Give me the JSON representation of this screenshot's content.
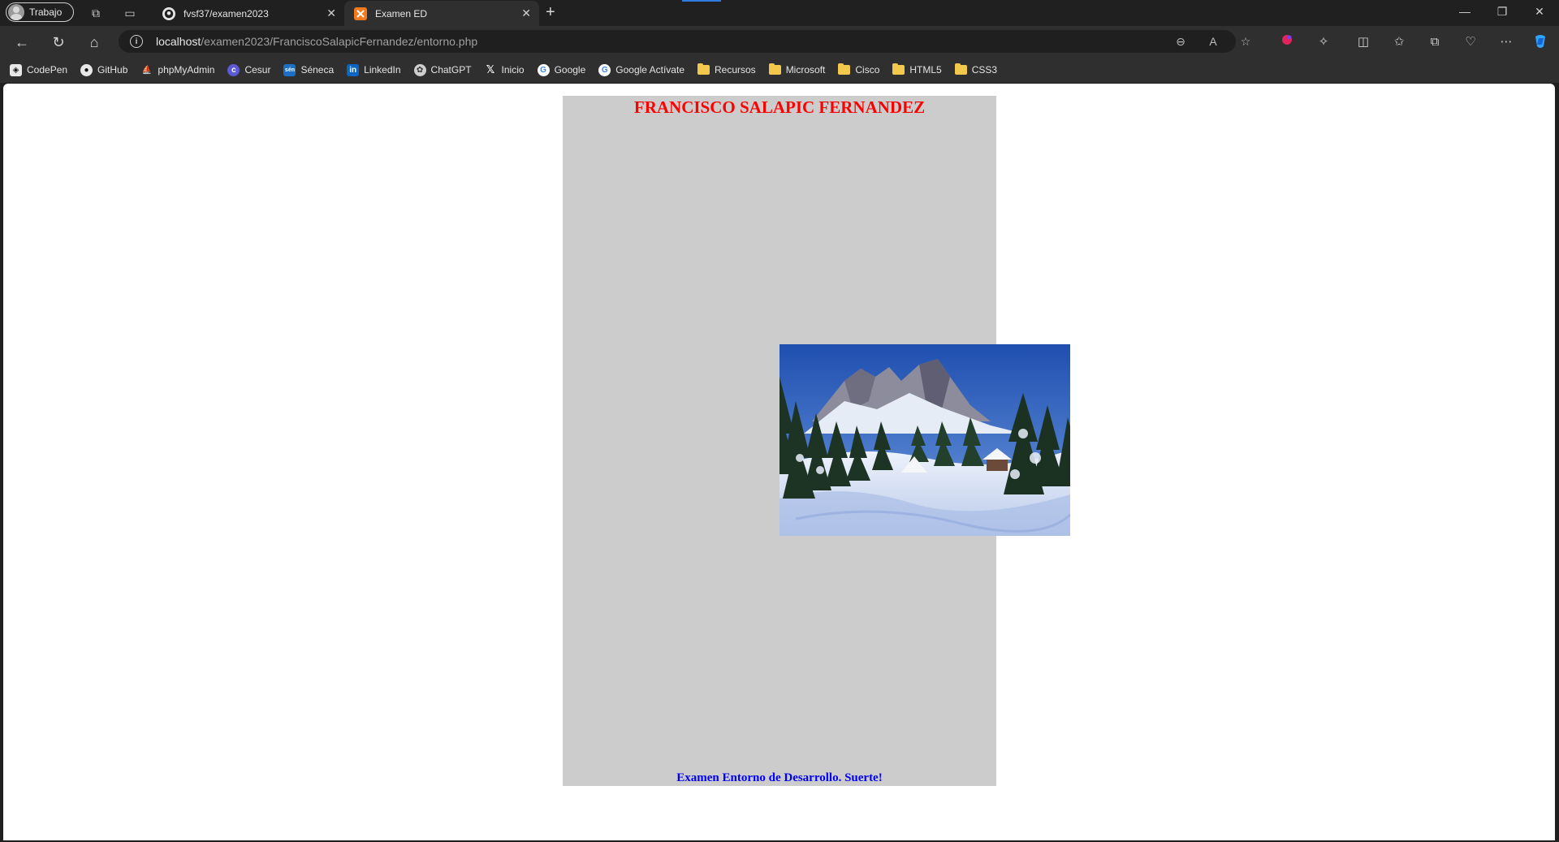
{
  "browser": {
    "profile_label": "Trabajo",
    "tabs": [
      {
        "title": "fvsf37/examen2023",
        "icon": "github-icon"
      },
      {
        "title": "Examen ED",
        "icon": "xampp-icon"
      }
    ],
    "url_host": "localhost",
    "url_path": "/examen2023/FranciscoSalapicFernandez/entorno.php",
    "bookmarks": [
      {
        "label": "CodePen",
        "icon": "codepen-icon"
      },
      {
        "label": "GitHub",
        "icon": "github-icon"
      },
      {
        "label": "phpMyAdmin",
        "icon": "phpmyadmin-icon"
      },
      {
        "label": "Cesur",
        "icon": "cesur-icon"
      },
      {
        "label": "Séneca",
        "icon": "seneca-icon"
      },
      {
        "label": "LinkedIn",
        "icon": "linkedin-icon"
      },
      {
        "label": "ChatGPT",
        "icon": "chatgpt-icon"
      },
      {
        "label": "Inicio",
        "icon": "x-icon"
      },
      {
        "label": "Google",
        "icon": "google-icon"
      },
      {
        "label": "Google Actívate",
        "icon": "google-icon"
      },
      {
        "label": "Recursos",
        "icon": "folder-icon"
      },
      {
        "label": "Microsoft",
        "icon": "folder-icon"
      },
      {
        "label": "Cisco",
        "icon": "folder-icon"
      },
      {
        "label": "HTML5",
        "icon": "folder-icon"
      },
      {
        "label": "CSS3",
        "icon": "folder-icon"
      }
    ]
  },
  "page": {
    "heading": "FRANCISCO SALAPIC FERNANDEZ",
    "image": "snowy-mountain-landscape",
    "footer": "Examen Entorno de Desarrollo. Suerte!",
    "colors": {
      "heading": "#ff0000",
      "footer": "#0000ff",
      "container_bg": "#cccccc"
    }
  }
}
